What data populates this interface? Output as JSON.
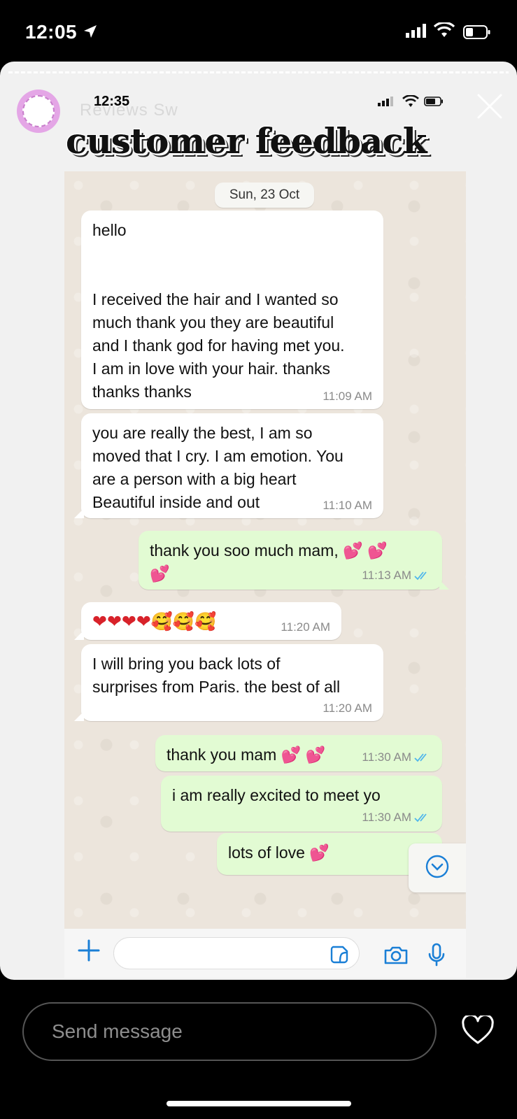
{
  "status_bar": {
    "time": "12:05"
  },
  "story": {
    "ghost_title": "Reviews Sw",
    "headline": "customer feedback"
  },
  "inner_status": {
    "time": "12:35"
  },
  "chat": {
    "date_chip": "Sun, 23 Oct",
    "messages": [
      {
        "direction": "incoming",
        "text": "hello\n\n\nI received the hair and I wanted so\nmuch thank you they are beautiful\nand I thank god for having met you.\nI am in love with your hair. thanks\nthanks thanks",
        "time": "11:09 AM"
      },
      {
        "direction": "incoming",
        "text": "you are really the best, I am so\nmoved that I cry. I am emotion. You\nare a person with a big heart\nBeautiful inside and out",
        "time": "11:10 AM"
      },
      {
        "direction": "outgoing",
        "text": "thank you soo much mam, 💕 💕\n💕",
        "time": "11:13 AM",
        "read": true
      },
      {
        "direction": "incoming",
        "text": "❤❤❤❤🥰🥰🥰",
        "time": "11:20 AM"
      },
      {
        "direction": "incoming",
        "text": "I will bring you back lots of\nsurprises from Paris. the best of all",
        "time": "11:20 AM"
      },
      {
        "direction": "outgoing",
        "text": "thank you mam 💕 💕",
        "time": "11:30 AM",
        "read": true
      },
      {
        "direction": "outgoing",
        "text": "i am really excited to meet yo",
        "time": "11:30 AM",
        "read": true
      },
      {
        "direction": "outgoing",
        "text": "lots of love 💕",
        "time": ""
      }
    ]
  },
  "reply_bar": {
    "placeholder": "Send message"
  },
  "colors": {
    "outgoing_bubble": "#e2fbd3",
    "incoming_bubble": "#ffffff",
    "whatsapp_blue": "#1a7fd6",
    "read_ticks": "#4fb6ec"
  },
  "icons": [
    "location-arrow-icon",
    "signal-icon",
    "wifi-icon",
    "battery-icon",
    "close-icon",
    "chevron-down-icon",
    "plus-icon",
    "sticker-icon",
    "camera-icon",
    "mic-icon",
    "heart-icon"
  ]
}
